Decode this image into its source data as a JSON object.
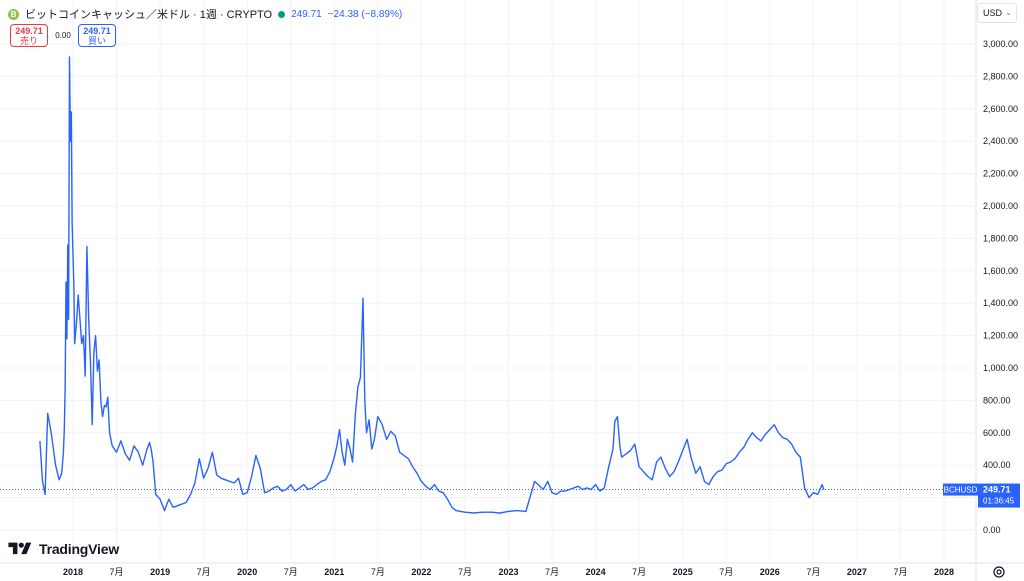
{
  "header": {
    "symbol_title": "ビットコインキャッシュ／米ドル · 1週 · CRYPTO",
    "last_price": "249.71",
    "change": "−24.38 (−8.89%)",
    "coin_icon_letter": "B",
    "status_color": "#089981"
  },
  "trade": {
    "sell_price": "249.71",
    "sell_label": "売り",
    "spread": "0.00",
    "buy_price": "249.71",
    "buy_label": "買い"
  },
  "currency": {
    "label": "USD"
  },
  "logo": {
    "text": "TradingView"
  },
  "colors": {
    "line": "#2962ff",
    "grid": "#f0f3fa",
    "sell": "#f23645",
    "buy": "#2962ff"
  },
  "chart_data": {
    "type": "line",
    "title": "",
    "xlabel": "",
    "ylabel": "",
    "ylim": [
      -100,
      3100
    ],
    "y_ticks": [
      0,
      200,
      400,
      600,
      800,
      1000,
      1200,
      1400,
      1600,
      1800,
      2000,
      2200,
      2400,
      2600,
      2800,
      3000
    ],
    "y_tick_labels": [
      "0.00",
      "200.00",
      "400.00",
      "600.00",
      "800.00",
      "1,000.00",
      "1,200.00",
      "1,400.00",
      "1,600.00",
      "1,800.00",
      "2,000.00",
      "2,200.00",
      "2,400.00",
      "2,600.00",
      "2,800.00",
      "3,000.00"
    ],
    "x_range": [
      2017.55,
      2028.35
    ],
    "x_ticks": [
      2018.0,
      2018.5,
      2019.0,
      2019.5,
      2020.0,
      2020.5,
      2021.0,
      2021.5,
      2022.0,
      2022.5,
      2023.0,
      2023.5,
      2024.0,
      2024.5,
      2025.0,
      2025.5,
      2026.0,
      2026.5,
      2027.0,
      2027.5,
      2028.0
    ],
    "x_tick_labels": [
      "2018",
      "7月",
      "2019",
      "7月",
      "2020",
      "7月",
      "2021",
      "7月",
      "2022",
      "7月",
      "2023",
      "7月",
      "2024",
      "7月",
      "2025",
      "7月",
      "2026",
      "7月",
      "2027",
      "7月",
      "2028"
    ],
    "series": [
      {
        "x": [
          2017.62,
          2017.65,
          2017.68,
          2017.71,
          2017.75,
          2017.8,
          2017.84,
          2017.87,
          2017.89,
          2017.9,
          2017.91,
          2017.92,
          2017.93,
          2017.94,
          2017.95,
          2017.96,
          2017.97,
          2017.98,
          2017.99,
          2018.0,
          2018.01,
          2018.02,
          2018.04,
          2018.06,
          2018.08,
          2018.1,
          2018.12,
          2018.14,
          2018.16,
          2018.18,
          2018.2,
          2018.22,
          2018.24,
          2018.26,
          2018.28,
          2018.3,
          2018.32,
          2018.34,
          2018.36,
          2018.38,
          2018.4,
          2018.42,
          2018.45,
          2018.5,
          2018.55,
          2018.6,
          2018.65,
          2018.7,
          2018.75,
          2018.8,
          2018.85,
          2018.88,
          2018.9,
          2018.92,
          2018.95,
          2019.0,
          2019.05,
          2019.1,
          2019.15,
          2019.2,
          2019.25,
          2019.3,
          2019.35,
          2019.4,
          2019.45,
          2019.5,
          2019.55,
          2019.6,
          2019.65,
          2019.7,
          2019.75,
          2019.8,
          2019.85,
          2019.9,
          2019.95,
          2020.0,
          2020.05,
          2020.1,
          2020.15,
          2020.2,
          2020.25,
          2020.3,
          2020.35,
          2020.4,
          2020.45,
          2020.5,
          2020.55,
          2020.6,
          2020.65,
          2020.7,
          2020.75,
          2020.8,
          2020.85,
          2020.9,
          2020.95,
          2021.0,
          2021.03,
          2021.06,
          2021.09,
          2021.12,
          2021.15,
          2021.18,
          2021.21,
          2021.24,
          2021.27,
          2021.3,
          2021.33,
          2021.35,
          2021.37,
          2021.4,
          2021.43,
          2021.46,
          2021.5,
          2021.55,
          2021.6,
          2021.65,
          2021.7,
          2021.75,
          2021.8,
          2021.85,
          2021.9,
          2021.95,
          2022.0,
          2022.05,
          2022.1,
          2022.15,
          2022.2,
          2022.25,
          2022.3,
          2022.35,
          2022.4,
          2022.45,
          2022.5,
          2022.6,
          2022.7,
          2022.8,
          2022.9,
          2023.0,
          2023.1,
          2023.2,
          2023.3,
          2023.4,
          2023.45,
          2023.48,
          2023.5,
          2023.55,
          2023.6,
          2023.65,
          2023.7,
          2023.75,
          2023.8,
          2023.85,
          2023.9,
          2023.95,
          2024.0,
          2024.05,
          2024.1,
          2024.15,
          2024.2,
          2024.22,
          2024.25,
          2024.28,
          2024.3,
          2024.35,
          2024.4,
          2024.45,
          2024.5,
          2024.55,
          2024.6,
          2024.65,
          2024.7,
          2024.75,
          2024.8,
          2024.85,
          2024.9,
          2024.95,
          2025.0,
          2025.05,
          2025.1,
          2025.15,
          2025.2,
          2025.25,
          2025.3,
          2025.35,
          2025.4,
          2025.45,
          2025.5,
          2025.55,
          2025.6,
          2025.65,
          2025.7,
          2025.75,
          2025.8,
          2025.85,
          2025.9,
          2025.95,
          2026.0,
          2026.05,
          2026.1,
          2026.15,
          2026.2,
          2026.25,
          2026.3,
          2026.35,
          2026.4,
          2026.45,
          2026.5,
          2026.55,
          2026.6,
          2026.62
        ],
        "values": [
          550,
          300,
          220,
          720,
          600,
          400,
          310,
          350,
          480,
          620,
          900,
          1530,
          1180,
          1760,
          1300,
          2920,
          2400,
          2580,
          1900,
          1700,
          1500,
          1150,
          1280,
          1450,
          1300,
          1150,
          1200,
          950,
          1750,
          1300,
          1050,
          650,
          1100,
          1200,
          980,
          1050,
          790,
          700,
          770,
          760,
          820,
          600,
          520,
          480,
          550,
          470,
          430,
          520,
          480,
          400,
          500,
          540,
          490,
          420,
          220,
          190,
          120,
          190,
          140,
          150,
          160,
          170,
          220,
          290,
          440,
          320,
          380,
          480,
          340,
          320,
          310,
          300,
          290,
          320,
          220,
          230,
          330,
          460,
          380,
          230,
          240,
          260,
          270,
          240,
          250,
          280,
          240,
          260,
          280,
          250,
          260,
          280,
          300,
          310,
          360,
          450,
          520,
          620,
          480,
          400,
          560,
          500,
          420,
          700,
          880,
          940,
          1430,
          800,
          600,
          680,
          500,
          560,
          700,
          650,
          560,
          610,
          580,
          480,
          460,
          440,
          390,
          350,
          300,
          270,
          250,
          280,
          240,
          230,
          190,
          140,
          120,
          115,
          110,
          105,
          110,
          110,
          105,
          115,
          120,
          115,
          300,
          250,
          300,
          260,
          230,
          220,
          240,
          240,
          250,
          260,
          270,
          250,
          260,
          250,
          280,
          240,
          260,
          390,
          500,
          670,
          700,
          510,
          450,
          470,
          490,
          530,
          390,
          360,
          330,
          310,
          420,
          450,
          380,
          330,
          360,
          420,
          490,
          560,
          440,
          350,
          390,
          300,
          280,
          330,
          360,
          370,
          410,
          420,
          440,
          480,
          510,
          560,
          600,
          570,
          550,
          590,
          620,
          650,
          600,
          570,
          560,
          530,
          480,
          450,
          260,
          200,
          230,
          220,
          280,
          250
        ],
        "values_note": ""
      }
    ],
    "last_value": 249.71,
    "symbol_label": "BCHUSD",
    "last_value_label": "249.71",
    "countdown_label": "01:36:45"
  }
}
